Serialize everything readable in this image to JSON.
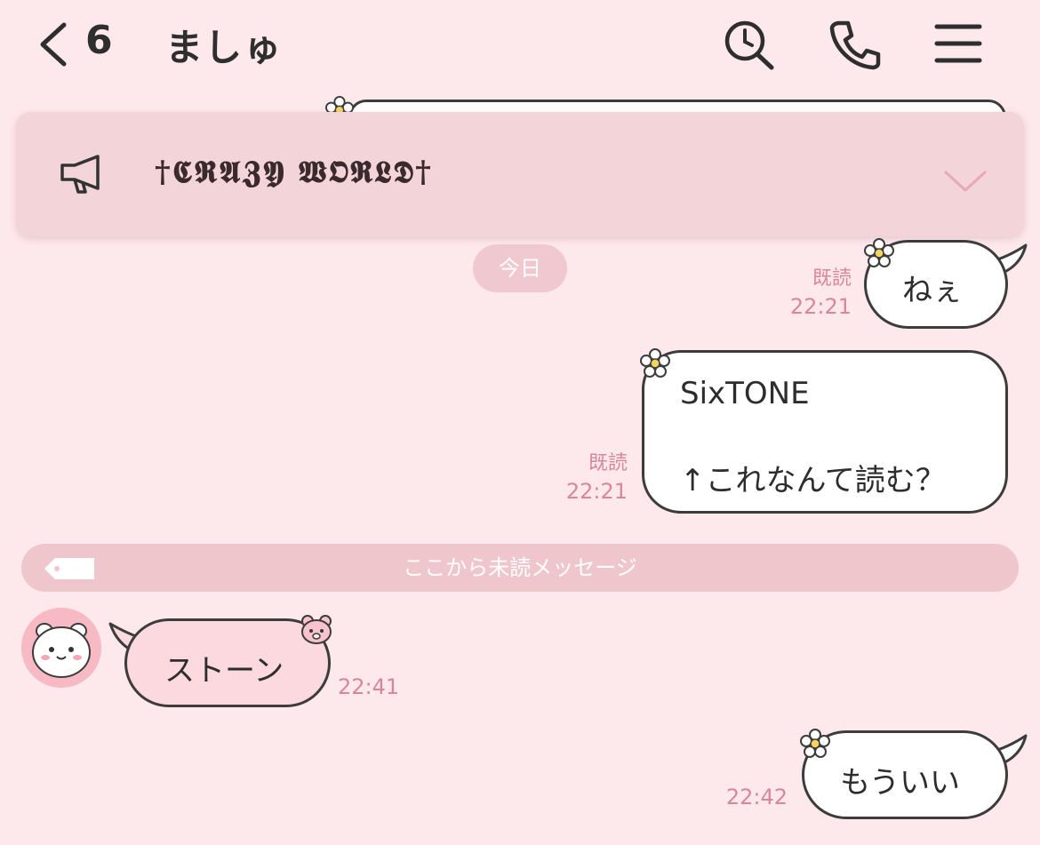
{
  "header": {
    "unread_count": "6",
    "title": "ましゅ",
    "icons": [
      "chevron-left-icon",
      "search-icon",
      "phone-icon",
      "menu-icon"
    ]
  },
  "announcement": {
    "text": "†𝕮𝕽𝕬𝖅𝖄 𝖂𝕺𝕽𝕷𝕯†",
    "icons": [
      "megaphone-icon",
      "chevron-down-icon"
    ]
  },
  "date_label": "今日",
  "messages": [
    {
      "side": "right",
      "text": "ねぇ",
      "read": "既読",
      "time": "22:21"
    },
    {
      "side": "right",
      "lines": [
        "SixTONE",
        "↑これなんて読む？"
      ],
      "read": "既読",
      "time": "22:21"
    },
    {
      "side": "left",
      "text": "ストーン",
      "time": "22:41"
    },
    {
      "side": "right",
      "text": "もういい",
      "time": "22:42"
    }
  ],
  "unread_divider": "ここから未読メッセージ",
  "colors": {
    "background": "#fde8eb",
    "meta_text": "#d8879a",
    "banner": "#f3d4d8",
    "incoming_bubble": "#fbd9de",
    "outgoing_bubble": "#ffffff"
  }
}
